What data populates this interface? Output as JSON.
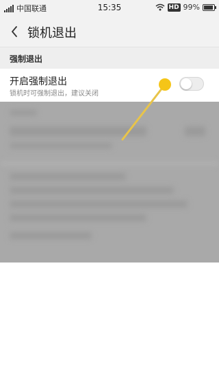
{
  "status_bar": {
    "carrier": "中国联通",
    "time": "15:35",
    "hd_label": "HD",
    "battery_percent": "99%",
    "battery_level": "47"
  },
  "header": {
    "title": "锁机退出",
    "back_icon": "chevron-left-icon"
  },
  "section": {
    "title": "强制退出"
  },
  "setting": {
    "title": "开启强制退出",
    "description": "锁机时可强制退出，建议关闭",
    "toggle_state": "off"
  },
  "colors": {
    "annotation_dot": "#f5c518",
    "annotation_line": "#e8c44a",
    "preview_gray": "#a9a9a9"
  }
}
